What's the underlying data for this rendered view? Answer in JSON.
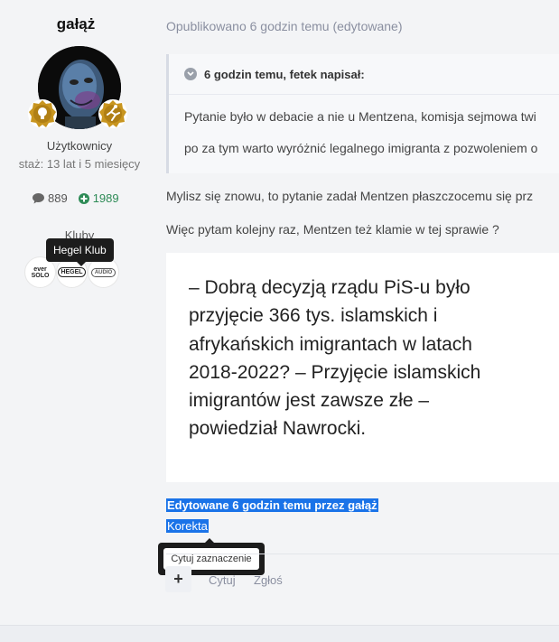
{
  "author": {
    "username": "gałąż",
    "role": "Użytkownicy",
    "joined": "staż: 13 lat i 5 miesięcy",
    "posts_count": "889",
    "reputation": "1989",
    "clubs_title": "Kluby",
    "clubs": [
      {
        "name": "ever solo",
        "logo_text": "ever SOLO"
      },
      {
        "name": "Hegel Klub",
        "logo_text": "HEGEL"
      },
      {
        "name": "Audio club",
        "logo_text": "AUDIO"
      }
    ],
    "club_tooltip": "Hegel Klub"
  },
  "post": {
    "meta": "Opublikowano 6 godzin temu (edytowane)",
    "quote": {
      "header": "6 godzin temu, fetek napisał:",
      "lines": [
        "Pytanie było w debacie a nie u Mentzena, komisja sejmowa twi",
        "po za tym warto wyróżnić legalnego imigranta z pozwoleniem o"
      ]
    },
    "paragraphs": [
      "Mylisz się znowu, to pytanie zadał Mentzen płaszczocemu się prz",
      "Więc pytam kolejny raz, Mentzen też klamie w tej sprawie ?"
    ],
    "embed_text": "– Dobrą decyzją rządu PiS-u było przyjęcie 366 tys. islamskich i afrykańskich imigrantach w latach 2018-2022? – Przyjęcie islamskich imigrantów jest zawsze złe – powiedział Nawrocki.",
    "edited_note": "Edytowane 6 godzin temu przez gałąż",
    "edit_reason": "Korekta",
    "quote_selection_label": "Cytuj zaznaczenie",
    "actions": {
      "quote": "Cytuj",
      "report": "Zgłoś"
    }
  },
  "colors": {
    "reputation": "#2e8b57",
    "selection": "#1a73e8",
    "meta": "#8a8fa0"
  }
}
